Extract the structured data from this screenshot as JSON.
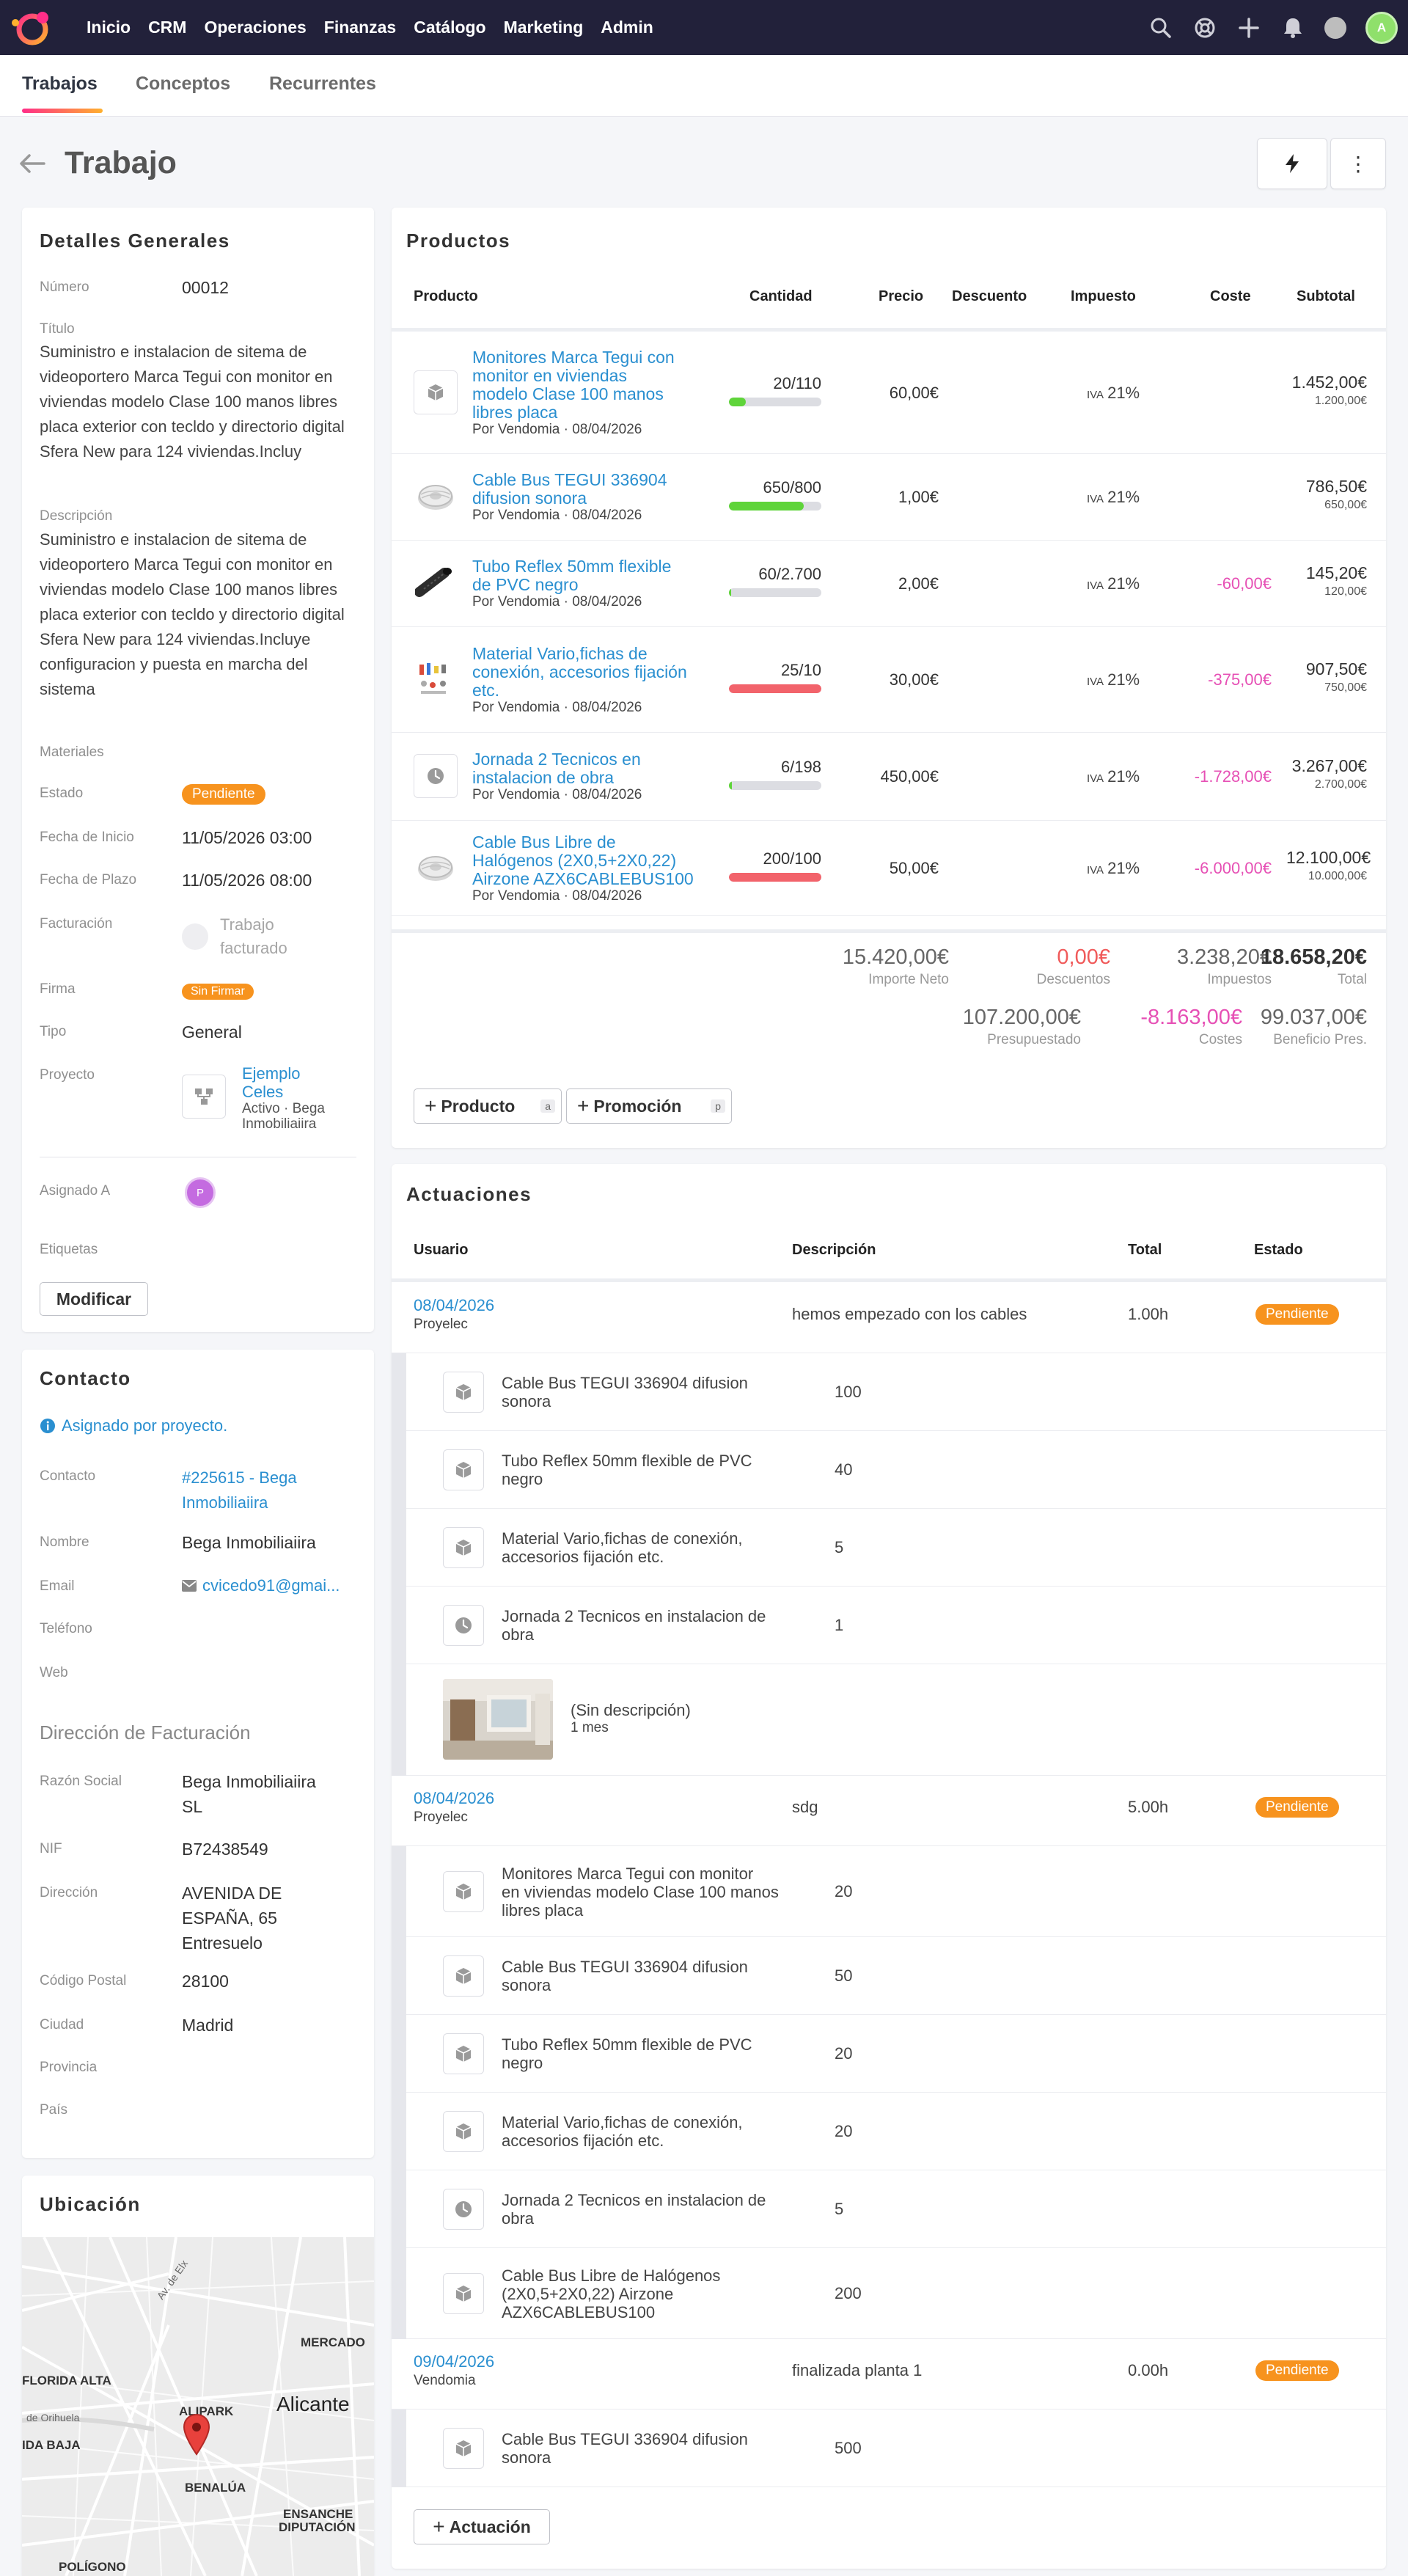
{
  "nav": {
    "menu": [
      "Inicio",
      "CRM",
      "Operaciones",
      "Finanzas",
      "Catálogo",
      "Marketing",
      "Admin"
    ],
    "avatar": "A",
    "colors": {
      "nav_bg": "#22213a",
      "accent": "#ff2e88",
      "link": "#2a8fd0",
      "badge": "#f7931e",
      "negative": "#e650b5"
    }
  },
  "tabs": [
    "Trabajos",
    "Conceptos",
    "Recurrentes"
  ],
  "page": {
    "title": "Trabajo",
    "more_icon": "⋮"
  },
  "details": {
    "title": "Detalles Generales",
    "numero_label": "Número",
    "numero": "00012",
    "titulo_label": "Título",
    "titulo": "Suministro e instalacion de sitema de videoportero Marca Tegui con monitor en viviendas modelo Clase 100 manos libres placa exterior con tecldo y directorio digital Sfera New para 124 viviendas.Incluy",
    "descripcion_label": "Descripción",
    "descripcion": "Suministro e instalacion de sitema de videoportero Marca Tegui con monitor en viviendas modelo Clase 100 manos libres placa exterior con tecldo y directorio digital Sfera New para 124 viviendas.Incluye configuracion y puesta en marcha del sistema",
    "materiales_label": "Materiales",
    "estado_label": "Estado",
    "estado": "Pendiente",
    "inicio_label": "Fecha de Inicio",
    "inicio": "11/05/2026 03:00",
    "plazo_label": "Fecha de Plazo",
    "plazo": "11/05/2026 08:00",
    "facturacion_label": "Facturación",
    "facturacion_l1": "Trabajo",
    "facturacion_l2": "facturado",
    "firma_label": "Firma",
    "firma": "Sin Firmar",
    "tipo_label": "Tipo",
    "tipo": "General",
    "proyecto_label": "Proyecto",
    "proyecto_l1": "Ejemplo",
    "proyecto_l2": "Celes",
    "proyecto_sub1": "Activo · Bega",
    "proyecto_sub2": "Inmobiliaiira",
    "asignado_label": "Asignado A",
    "asignado_avatar": "P",
    "etiquetas_label": "Etiquetas",
    "modificar": "Modificar"
  },
  "contact": {
    "title": "Contacto",
    "info": "Asignado por proyecto.",
    "contacto_label": "Contacto",
    "contacto_l1": "#225615 - Bega",
    "contacto_l2": "Inmobiliaiira",
    "nombre_label": "Nombre",
    "nombre": "Bega Inmobiliaiira",
    "email_label": "Email",
    "email": "cvicedo91@gmai...",
    "telefono_label": "Teléfono",
    "web_label": "Web",
    "fact_title": "Dirección de Facturación",
    "razon_label": "Razón Social",
    "razon_l1": "Bega Inmobiliaiira",
    "razon_l2": "SL",
    "nif_label": "NIF",
    "nif": "B72438549",
    "dir_label": "Dirección",
    "dir_l1": "AVENIDA DE",
    "dir_l2": "ESPAÑA, 65",
    "dir_l3": "Entresuelo",
    "cp_label": "Código Postal",
    "cp": "28100",
    "ciudad_label": "Ciudad",
    "ciudad": "Madrid",
    "provincia_label": "Provincia",
    "pais_label": "País"
  },
  "location": {
    "title": "Ubicación",
    "labels": [
      "FLORIDA ALTA",
      "ALIPARK",
      "Alicante",
      "MERCADO",
      "IDA BAJA",
      "BENALÚA",
      "ENSANCHE",
      "DIPUTACIÓN",
      "POLÍGONO",
      "de Orihuela",
      "Av. de Elx"
    ]
  },
  "products": {
    "title": "Productos",
    "headers": [
      "Producto",
      "Cantidad",
      "Precio",
      "Descuento",
      "Impuesto",
      "Coste",
      "Subtotal"
    ],
    "tax_prefix": "IVA",
    "rows": [
      {
        "name": [
          "Monitores Marca Tegui con",
          "monitor en viviendas",
          "modelo Clase 100 manos",
          "libres placa"
        ],
        "by": "Por Vendomia · 08/04/2026",
        "qty": "20/110",
        "fill": 0.18,
        "bar": "#5fd43a",
        "price": "60,00€",
        "tax": "21%",
        "cost": "",
        "sub": "1.452,00€",
        "sub2": "1.200,00€",
        "icon": "box-icon"
      },
      {
        "name": [
          "Cable Bus TEGUI 336904",
          "difusion sonora"
        ],
        "by": "Por Vendomia · 08/04/2026",
        "qty": "650/800",
        "fill": 0.81,
        "bar": "#5fd43a",
        "price": "1,00€",
        "tax": "21%",
        "cost": "",
        "sub": "786,50€",
        "sub2": "650,00€",
        "icon": "cable-thumb"
      },
      {
        "name": [
          "Tubo Reflex 50mm flexible",
          "de PVC negro"
        ],
        "by": "Por Vendomia · 08/04/2026",
        "qty": "60/2.700",
        "fill": 0.02,
        "bar": "#5fd43a",
        "price": "2,00€",
        "tax": "21%",
        "cost": "-60,00€",
        "sub": "145,20€",
        "sub2": "120,00€",
        "icon": "tube-thumb"
      },
      {
        "name": [
          "Material Vario,fichas de",
          "conexión, accesorios fijación",
          "etc."
        ],
        "by": "Por Vendomia · 08/04/2026",
        "qty": "25/10",
        "fill": 1,
        "bar": "#f2636b",
        "price": "30,00€",
        "tax": "21%",
        "cost": "-375,00€",
        "sub": "907,50€",
        "sub2": "750,00€",
        "icon": "material-thumb"
      },
      {
        "name": [
          "Jornada 2 Tecnicos en",
          "instalacion de obra"
        ],
        "by": "Por Vendomia · 08/04/2026",
        "qty": "6/198",
        "fill": 0.03,
        "bar": "#5fd43a",
        "price": "450,00€",
        "tax": "21%",
        "cost": "-1.728,00€",
        "sub": "3.267,00€",
        "sub2": "2.700,00€",
        "icon": "clock-icon"
      },
      {
        "name": [
          "Cable Bus Libre de",
          "Halógenos (2X0,5+2X0,22)",
          "Airzone AZX6CABLEBUS100"
        ],
        "by": "Por Vendomia · 08/04/2026",
        "qty": "200/100",
        "fill": 1,
        "bar": "#f2636b",
        "price": "50,00€",
        "tax": "21%",
        "cost": "-6.000,00€",
        "sub": "12.100,00€",
        "sub2": "10.000,00€",
        "icon": "cable-thumb"
      }
    ],
    "totals": {
      "neto": "15.420,00€",
      "neto_l": "Importe Neto",
      "desc": "0,00€",
      "desc_l": "Descuentos",
      "imp": "3.238,20€",
      "imp_l": "Impuestos",
      "total": "18.658,20€",
      "total_l": "Total",
      "pres": "107.200,00€",
      "pres_l": "Presupuestado",
      "costes": "-8.163,00€",
      "costes_l": "Costes",
      "benef": "99.037,00€",
      "benef_l": "Beneficio Pres."
    },
    "add_product": "Producto",
    "add_product_key": "a",
    "add_promo": "Promoción",
    "add_promo_key": "p"
  },
  "actions": {
    "title": "Actuaciones",
    "headers": [
      "Usuario",
      "Descripción",
      "Total",
      "Estado"
    ],
    "groups": [
      {
        "date": "08/04/2026",
        "user": "Proyelec",
        "desc": "hemos empezado con los cables",
        "total": "1.00h",
        "state": "Pendiente",
        "items": [
          {
            "name": [
              "Cable Bus TEGUI 336904 difusion",
              "sonora"
            ],
            "qty": "100",
            "icon": "box-icon"
          },
          {
            "name": [
              "Tubo Reflex 50mm flexible de PVC",
              "negro"
            ],
            "qty": "40",
            "icon": "box-icon"
          },
          {
            "name": [
              "Material Vario,fichas de conexión,",
              "accesorios fijación etc."
            ],
            "qty": "5",
            "icon": "box-icon"
          },
          {
            "name": [
              "Jornada 2 Tecnicos en instalacion de",
              "obra"
            ],
            "qty": "1",
            "icon": "clock-icon"
          }
        ],
        "photo": {
          "desc": "(Sin descripción)",
          "age": "1 mes"
        }
      },
      {
        "date": "08/04/2026",
        "user": "Proyelec",
        "desc": "sdg",
        "total": "5.00h",
        "state": "Pendiente",
        "items": [
          {
            "name": [
              "Monitores Marca Tegui con monitor",
              "en viviendas modelo Clase 100 manos",
              "libres placa"
            ],
            "qty": "20",
            "icon": "box-icon"
          },
          {
            "name": [
              "Cable Bus TEGUI 336904 difusion",
              "sonora"
            ],
            "qty": "50",
            "icon": "box-icon"
          },
          {
            "name": [
              "Tubo Reflex 50mm flexible de PVC",
              "negro"
            ],
            "qty": "20",
            "icon": "box-icon"
          },
          {
            "name": [
              "Material Vario,fichas de conexión,",
              "accesorios fijación etc."
            ],
            "qty": "20",
            "icon": "box-icon"
          },
          {
            "name": [
              "Jornada 2 Tecnicos en instalacion de",
              "obra"
            ],
            "qty": "5",
            "icon": "clock-icon"
          },
          {
            "name": [
              "Cable Bus Libre de Halógenos",
              "(2X0,5+2X0,22) Airzone",
              "AZX6CABLEBUS100"
            ],
            "qty": "200",
            "icon": "box-icon"
          }
        ]
      },
      {
        "date": "09/04/2026",
        "user": "Vendomia",
        "desc": "finalizada planta 1",
        "total": "0.00h",
        "state": "Pendiente",
        "items": [
          {
            "name": [
              "Cable Bus TEGUI 336904 difusion",
              "sonora"
            ],
            "qty": "500",
            "icon": "box-icon"
          }
        ]
      }
    ],
    "add": "Actuación"
  }
}
